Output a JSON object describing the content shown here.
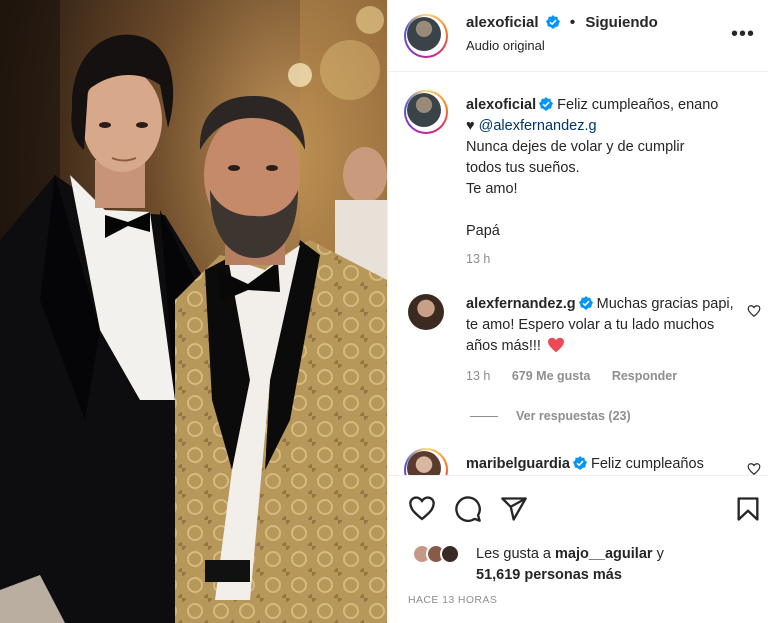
{
  "post": {
    "author": "alexoficial",
    "follow_separator": "•",
    "follow_status": "Siguiendo",
    "audio": "Audio original",
    "more_menu": "more-horizontal-icon"
  },
  "caption": {
    "username": "alexoficial",
    "text_lead": "Feliz cumpleaños, enano",
    "heart": "♥",
    "mention": "@alexfernandez.g",
    "line2": "Nunca dejes de volar y de cumplir",
    "line3": "todos tus sueños.",
    "line4": "Te amo!",
    "line5": "Papá",
    "time": "13 h"
  },
  "comments": [
    {
      "username": "alexfernandez.g",
      "text": "Muchas gracias papi, te amo! Espero volar a tu lado muchos años más!!!",
      "time": "13 h",
      "likes": "679 Me gusta",
      "reply": "Responder",
      "view_replies": "Ver respuestas (23)"
    },
    {
      "username": "maribelguardia",
      "text": "Feliz cumpleaños"
    }
  ],
  "actions": {
    "like": "heart-icon",
    "comment": "comment-icon",
    "share": "send-icon",
    "save": "bookmark-icon"
  },
  "likes": {
    "prefix": "Les gusta a",
    "first_user": "majo__aguilar",
    "connector": "y",
    "count_text": "51,619 personas más"
  },
  "timestamp": "HACE 13 HORAS",
  "colors": {
    "verified": "#0095f6",
    "red_heart": "#ed4956",
    "link": "#00376b",
    "muted": "#8e8e8e"
  }
}
